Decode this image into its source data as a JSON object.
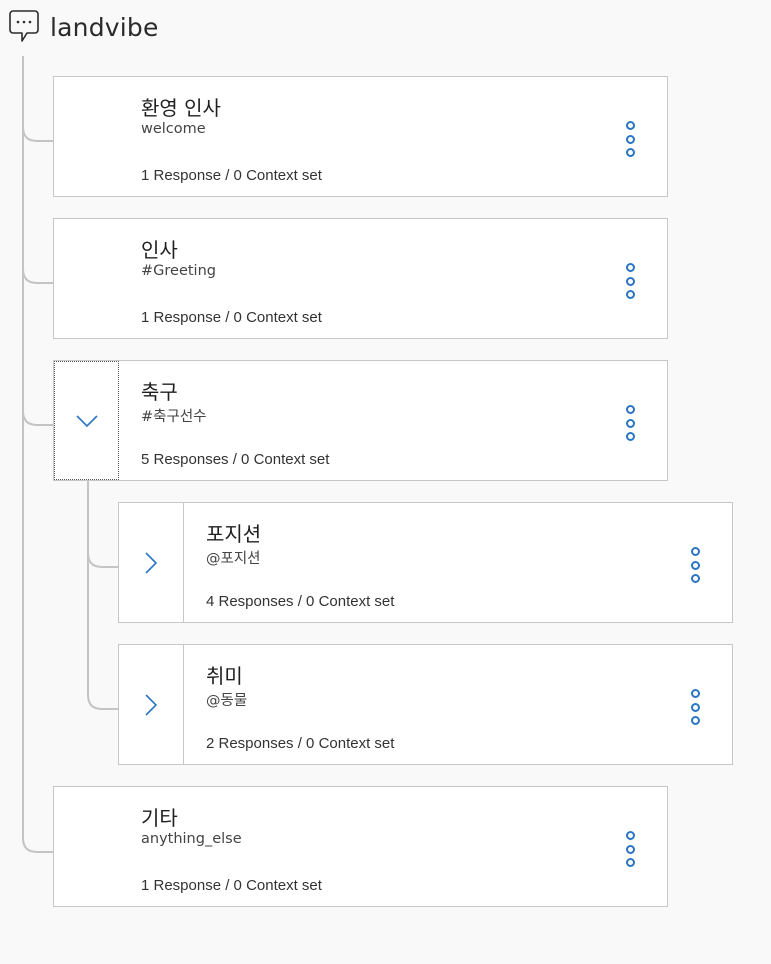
{
  "app": {
    "title": "landvibe",
    "icon": "chat-bubble-icon"
  },
  "accent_color": "#2a75c4",
  "connector_color": "#c4c4c4",
  "nodes": [
    {
      "id": "welcome",
      "title": "환영 인사",
      "condition": "welcome",
      "meta": "1 Response / 0 Context set",
      "toggle": "none"
    },
    {
      "id": "greeting",
      "title": "인사",
      "condition": "#Greeting",
      "meta": "1 Response / 0 Context set",
      "toggle": "none"
    },
    {
      "id": "soccer",
      "title": "축구",
      "condition": "#축구선수",
      "meta": "5 Responses / 0 Context set",
      "toggle": "expanded"
    },
    {
      "id": "position",
      "title": "포지션",
      "condition": "@포지션",
      "meta": "4 Responses / 0 Context set",
      "toggle": "collapsed"
    },
    {
      "id": "hobby",
      "title": "취미",
      "condition": "@동물",
      "meta": "2 Responses / 0 Context set",
      "toggle": "collapsed"
    },
    {
      "id": "anything-else",
      "title": "기타",
      "condition": "anything_else",
      "meta": "1 Response / 0 Context set",
      "toggle": "none"
    }
  ]
}
